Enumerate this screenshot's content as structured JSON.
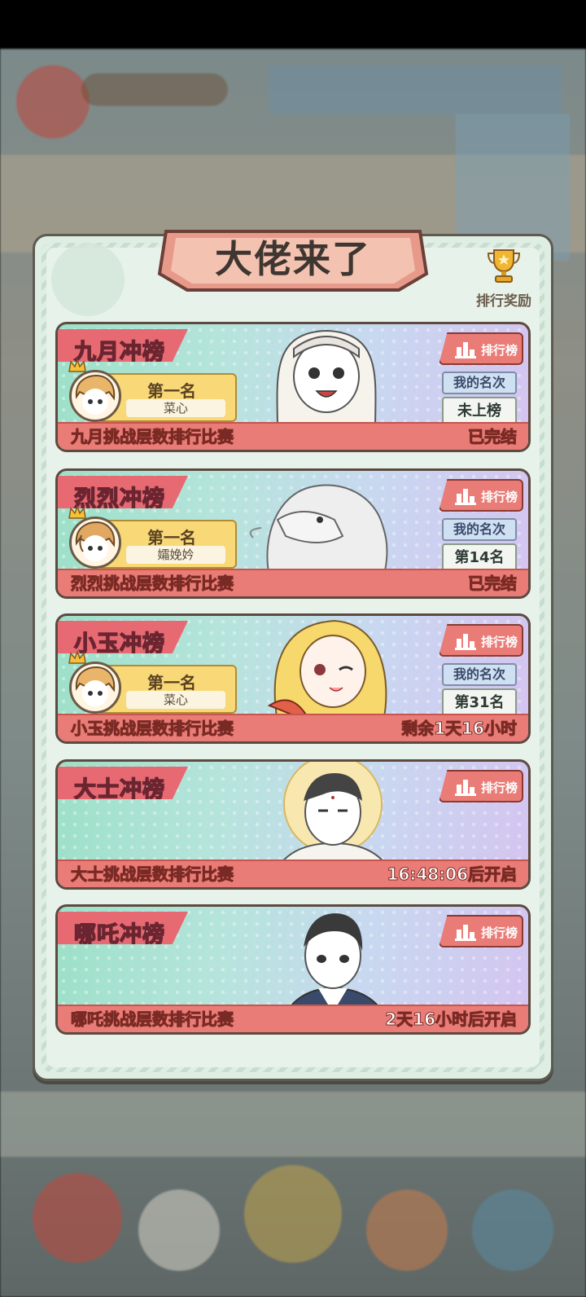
{
  "panel": {
    "title": "大佬来了",
    "reward_label": "排行奖励"
  },
  "common": {
    "rank_button_label": "排行榜",
    "my_rank_label": "我的名次",
    "champion_title": "第一名"
  },
  "cards": [
    {
      "tag": "九月冲榜",
      "champion": "菜心",
      "my_rank": "未上榜",
      "footer_left": "九月挑战层数排行比赛",
      "footer_right": "已完结"
    },
    {
      "tag": "烈烈冲榜",
      "champion": "孀娩妗",
      "my_rank": "第14名",
      "footer_left": "烈烈挑战层数排行比赛",
      "footer_right": "已完结"
    },
    {
      "tag": "小玉冲榜",
      "champion": "菜心",
      "my_rank": "第31名",
      "footer_left": "小玉挑战层数排行比赛",
      "footer_right": "剩余1天16小时"
    },
    {
      "tag": "大士冲榜",
      "footer_left": "大士挑战层数排行比赛",
      "footer_right": "16:48:06后开启"
    },
    {
      "tag": "哪吒冲榜",
      "footer_left": "哪吒挑战层数排行比赛",
      "footer_right": "2天16小时后开启"
    }
  ],
  "icons": {
    "trophy": "trophy-icon",
    "rank": "bar-chart-icon",
    "crown": "crown-icon"
  }
}
